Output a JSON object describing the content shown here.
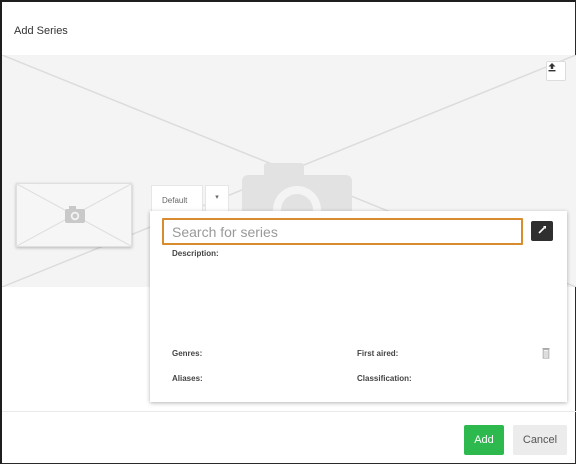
{
  "dialog": {
    "title": "Add Series"
  },
  "banner": {
    "upload_icon": "upload-icon"
  },
  "tabs": {
    "language": "Default",
    "more_icon": "chevron-down-icon"
  },
  "search": {
    "placeholder": "Search for series",
    "value": ""
  },
  "fields": {
    "description": "Description:",
    "genres": "Genres:",
    "first_aired": "First aired:",
    "aliases": "Aliases:",
    "classification": "Classification:"
  },
  "footer": {
    "add_label": "Add",
    "cancel_label": "Cancel"
  },
  "colors": {
    "accent_border": "#d98c2e",
    "add_button": "#2db94e",
    "magic_button": "#2f2f2f"
  }
}
